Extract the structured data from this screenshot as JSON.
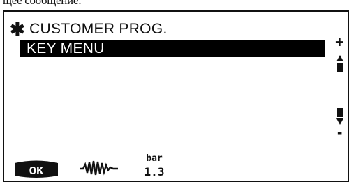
{
  "caption": "щее сообщение:",
  "screen": {
    "title": "CUSTOMER PROG.",
    "title_marker": "✱",
    "selected_item": "KEY MENU",
    "plus_label": "+",
    "minus_label": "-"
  },
  "softkeys": {
    "ok_label": "OK",
    "wave_icon": "waveform-icon",
    "bar_icon": "bar-value-icon",
    "bar_top": "bar",
    "bar_value": "1.3"
  }
}
